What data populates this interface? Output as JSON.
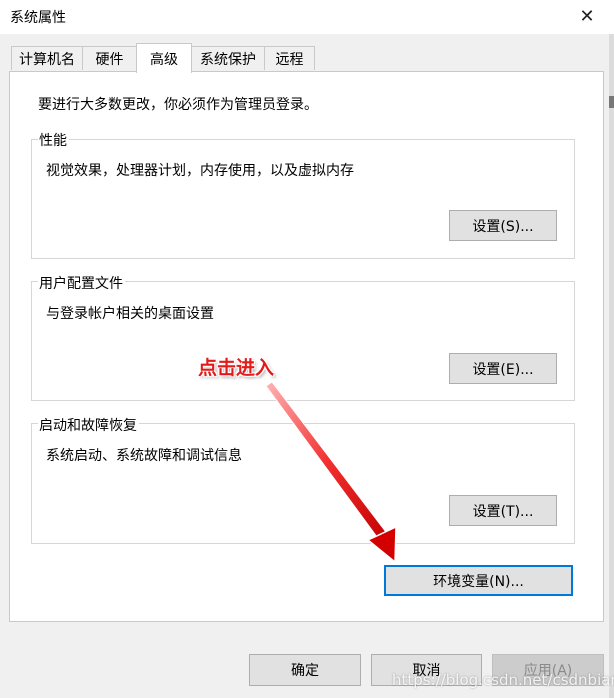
{
  "window": {
    "title": "系统属性",
    "close_glyph": "✕"
  },
  "tabs": [
    {
      "label": "计算机名"
    },
    {
      "label": "硬件"
    },
    {
      "label": "高级"
    },
    {
      "label": "系统保护"
    },
    {
      "label": "远程"
    }
  ],
  "intro": "要进行大多数更改，你必须作为管理员登录。",
  "groups": {
    "performance": {
      "title": "性能",
      "desc": "视觉效果，处理器计划，内存使用，以及虚拟内存",
      "button": "设置(S)..."
    },
    "profile": {
      "title": "用户配置文件",
      "desc": "与登录帐户相关的桌面设置",
      "button": "设置(E)..."
    },
    "startup": {
      "title": "启动和故障恢复",
      "desc": "系统启动、系统故障和调试信息",
      "button": "设置(T)..."
    }
  },
  "env_button": "环境变量(N)...",
  "footer": {
    "ok": "确定",
    "cancel": "取消",
    "apply": "应用(A)"
  },
  "annotation": {
    "text": "点击进入",
    "color": "#e21a1a"
  },
  "watermark": "https://blog.csdn.net/csdnbian",
  "colors": {
    "focus": "#0078d7",
    "button_bg": "#e1e1e1"
  },
  "icons": {
    "close": "close-icon",
    "arrow": "red-arrow-annotation"
  }
}
